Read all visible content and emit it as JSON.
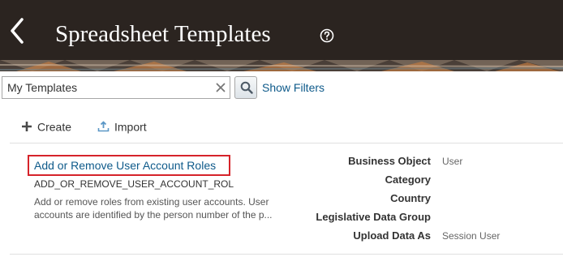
{
  "header": {
    "title": "Spreadsheet Templates",
    "back_icon": "chevron-left-icon",
    "help_icon": "help-circle-icon",
    "background_color": "#2b2420"
  },
  "search": {
    "value": "My Templates",
    "placeholder": "",
    "search_icon": "search-icon",
    "clear_icon": "close-icon",
    "show_filters_label": "Show Filters"
  },
  "toolbar": {
    "create_label": "Create",
    "import_label": "Import"
  },
  "templates": [
    {
      "name": "Add or Remove User Account Roles",
      "code": "ADD_OR_REMOVE_USER_ACCOUNT_ROL",
      "description_line1": "Add or remove roles from existing user accounts. User",
      "description_line2": "accounts are identified by the person number of the p...",
      "attributes": [
        {
          "label": "Business Object",
          "value": "User"
        },
        {
          "label": "Category",
          "value": ""
        },
        {
          "label": "Country",
          "value": ""
        },
        {
          "label": "Legislative Data Group",
          "value": ""
        },
        {
          "label": "Upload Data As",
          "value": "Session User"
        }
      ]
    }
  ],
  "colors": {
    "link": "#0e5a8a",
    "highlight_border": "#d6232a"
  }
}
